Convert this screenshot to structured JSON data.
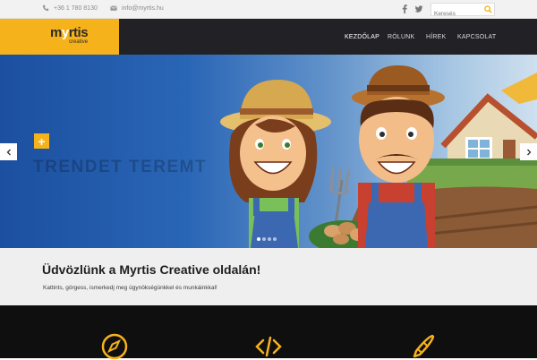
{
  "topbar": {
    "phone": "+36 1 780 8130",
    "email": "info@myrtis.hu",
    "social": [
      "facebook-icon",
      "twitter-icon"
    ],
    "search_placeholder": "Keresés"
  },
  "brand": {
    "name_start": "m",
    "name_y": "y",
    "name_end": "rtis",
    "sub": "creative",
    "accent": "#f6b21b"
  },
  "nav": {
    "items": [
      "KEZDŐLAP",
      "RÓLUNK",
      "HÍREK",
      "KAPCSOLAT"
    ],
    "active_index": 0
  },
  "slider": {
    "ghost_text": "TRENDET TEREMT",
    "slide_count": 4,
    "active_slide": 0
  },
  "welcome": {
    "title": "Üdvözlünk a Myrtis Creative oldalán!",
    "text": "Kattints, görgess, ismerkedj meg ügynökségünkkel és munkáinkkal!"
  },
  "services": {
    "icons": [
      "compass-icon",
      "code-icon",
      "pen-icon"
    ]
  }
}
